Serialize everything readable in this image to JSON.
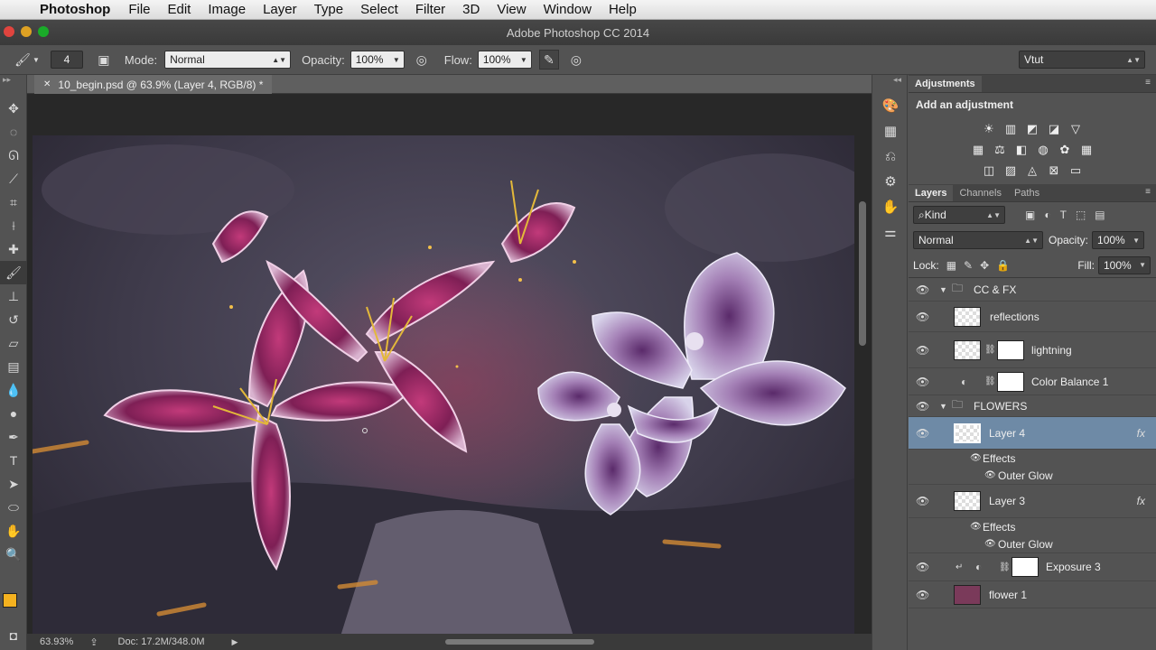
{
  "menubar": {
    "app_name": "Photoshop",
    "items": [
      "File",
      "Edit",
      "Image",
      "Layer",
      "Type",
      "Select",
      "Filter",
      "3D",
      "View",
      "Window",
      "Help"
    ]
  },
  "window": {
    "title": "Adobe Photoshop CC 2014"
  },
  "options": {
    "brush_size": "4",
    "mode_label": "Mode:",
    "mode_value": "Normal",
    "opacity_label": "Opacity:",
    "opacity_value": "100%",
    "flow_label": "Flow:",
    "flow_value": "100%",
    "workspace": "Vtut"
  },
  "document": {
    "tab_title": "10_begin.psd @ 63.9% (Layer 4, RGB/8) *",
    "zoom": "63.93%",
    "doc_size": "Doc: 17.2M/348.0M"
  },
  "adjustments": {
    "panel_title": "Adjustments",
    "heading": "Add an adjustment"
  },
  "layers_panel": {
    "tabs": [
      "Layers",
      "Channels",
      "Paths"
    ],
    "filter_value": "Kind",
    "blend_mode": "Normal",
    "opacity_label": "Opacity:",
    "opacity_value": "100%",
    "lock_label": "Lock:",
    "fill_label": "Fill:",
    "fill_value": "100%",
    "groups": {
      "g1": "CC & FX",
      "g2": "FLOWERS"
    },
    "layers": {
      "reflections": "reflections",
      "lightning": "lightning",
      "color_balance": "Color Balance 1",
      "layer4": "Layer 4",
      "layer3": "Layer 3",
      "exposure": "Exposure 3",
      "flower1": "flower 1"
    },
    "effects_label": "Effects",
    "outer_glow_label": "Outer Glow",
    "fx_badge": "fx"
  },
  "colors": {
    "foreground": "#f5b21f",
    "background": "#ffffff",
    "selected_layer": "#6e8aa6"
  }
}
